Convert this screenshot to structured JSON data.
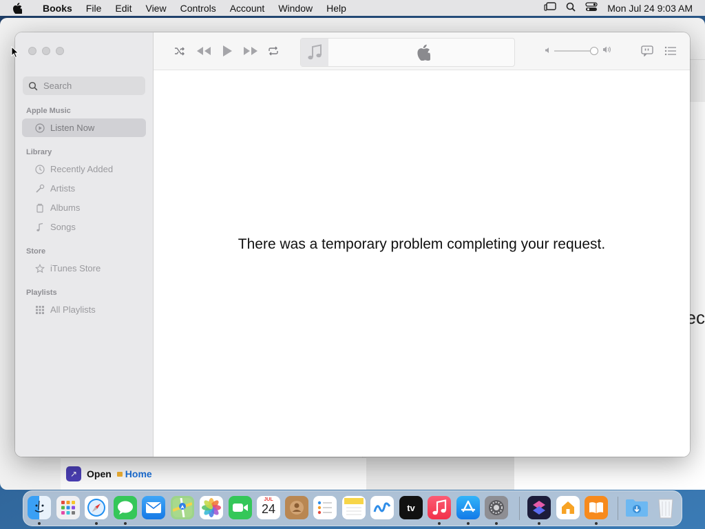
{
  "menubar": {
    "app_name": "Books",
    "items": [
      "File",
      "Edit",
      "View",
      "Controls",
      "Account",
      "Window",
      "Help"
    ],
    "clock": "Mon Jul 24  9:03 AM"
  },
  "background_window": {
    "open_label": "Open",
    "home_label": "Home",
    "partial_text": "ec"
  },
  "music": {
    "search_placeholder": "Search",
    "sections": {
      "apple_music": "Apple Music",
      "library": "Library",
      "store": "Store",
      "playlists": "Playlists"
    },
    "items": {
      "listen_now": "Listen Now",
      "recently_added": "Recently Added",
      "artists": "Artists",
      "albums": "Albums",
      "songs": "Songs",
      "itunes_store": "iTunes Store",
      "all_playlists": "All Playlists"
    },
    "error_message": "There was a temporary problem completing your request."
  },
  "dock": {
    "calendar_month": "JUL",
    "calendar_day": "24",
    "tv_label": "tv"
  },
  "colors": {
    "accent": "#1a6fd8",
    "sidebar_bg": "#e9e9eb"
  }
}
